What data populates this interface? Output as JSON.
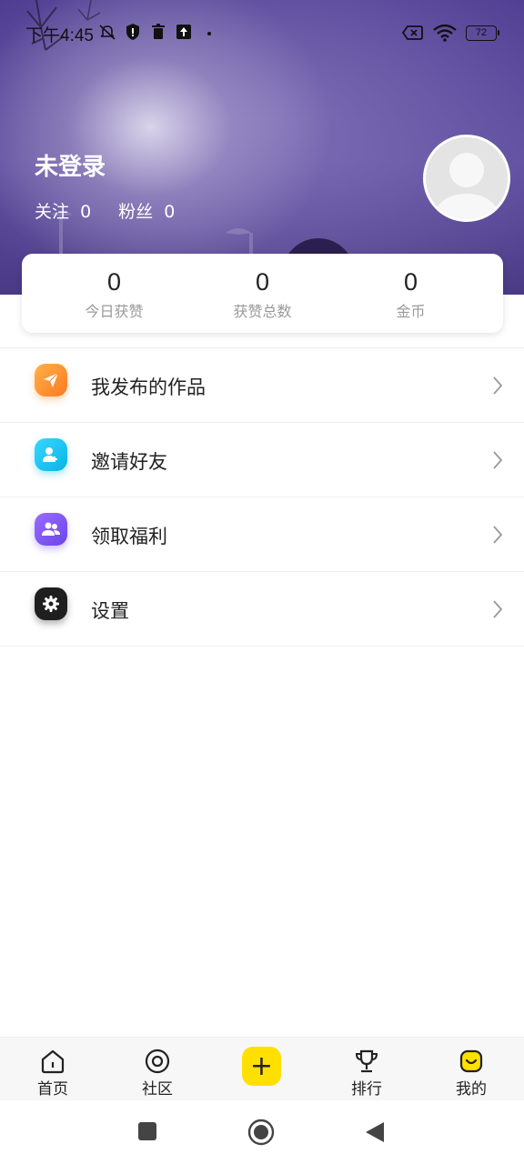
{
  "status_bar": {
    "time": "下午4:45",
    "battery": "72"
  },
  "profile": {
    "username": "未登录",
    "follow_label": "关注",
    "follow_count": "0",
    "fans_label": "粉丝",
    "fans_count": "0"
  },
  "stats": [
    {
      "value": "0",
      "label": "今日获赞"
    },
    {
      "value": "0",
      "label": "获赞总数"
    },
    {
      "value": "0",
      "label": "金币"
    }
  ],
  "menu": [
    {
      "label": "我发布的作品",
      "icon": "send-icon",
      "color": "#ff8a2b"
    },
    {
      "label": "邀请好友",
      "icon": "invite-user-icon",
      "color": "#1cc6f0"
    },
    {
      "label": "领取福利",
      "icon": "users-icon",
      "color": "#7d55f0"
    },
    {
      "label": "设置",
      "icon": "gear-icon",
      "color": "#1f1f1f"
    }
  ],
  "tabbar": {
    "items": [
      {
        "label": "首页",
        "icon": "home-icon"
      },
      {
        "label": "社区",
        "icon": "community-icon"
      },
      {
        "label": "",
        "icon": "plus-icon"
      },
      {
        "label": "排行",
        "icon": "trophy-icon"
      },
      {
        "label": "我的",
        "icon": "smile-icon"
      }
    ],
    "add_symbol": "+",
    "accent": "#ffe000"
  },
  "nav": {
    "items": [
      "recents-button",
      "home-button",
      "back-button"
    ]
  }
}
